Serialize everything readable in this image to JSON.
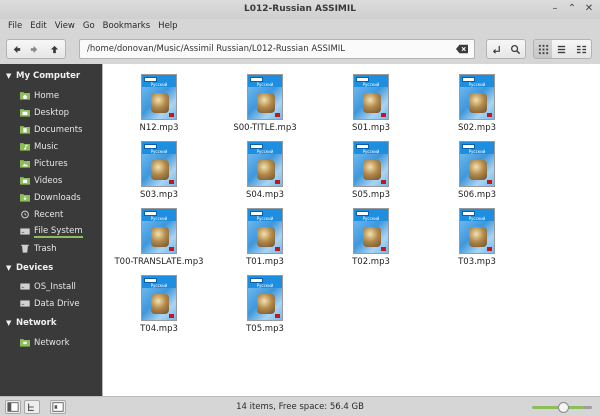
{
  "window": {
    "title": "L012-Russian ASSIMIL"
  },
  "menu": [
    "File",
    "Edit",
    "View",
    "Go",
    "Bookmarks",
    "Help"
  ],
  "location": {
    "path": "/home/donovan/Music/Assimil Russian/L012-Russian ASSIMIL"
  },
  "sidebar": {
    "sections": [
      {
        "header": "My Computer",
        "items": [
          "Home",
          "Desktop",
          "Documents",
          "Music",
          "Pictures",
          "Videos",
          "Downloads",
          "Recent",
          "File System",
          "Trash"
        ]
      },
      {
        "header": "Devices",
        "items": [
          "OS_Install",
          "Data Drive"
        ]
      },
      {
        "header": "Network",
        "items": [
          "Network"
        ]
      }
    ]
  },
  "files": [
    {
      "name": "N12.mp3"
    },
    {
      "name": "S00-TITLE.mp3"
    },
    {
      "name": "S01.mp3"
    },
    {
      "name": "S02.mp3"
    },
    {
      "name": "S03.mp3"
    },
    {
      "name": "S04.mp3"
    },
    {
      "name": "S05.mp3"
    },
    {
      "name": "S06.mp3"
    },
    {
      "name": "T00-TRANSLATE.mp3"
    },
    {
      "name": "T01.mp3"
    },
    {
      "name": "T02.mp3"
    },
    {
      "name": "T03.mp3"
    },
    {
      "name": "T04.mp3"
    },
    {
      "name": "T05.mp3"
    }
  ],
  "thumb_caption": "Русский",
  "status": {
    "text": "14 items, Free space: 56.4 GB"
  },
  "zoom": {
    "fraction": 0.55
  },
  "colors": {
    "sidebar_bg": "#3a3a3a",
    "accent": "#8dbc5a",
    "content_bg": "#ffffff"
  }
}
